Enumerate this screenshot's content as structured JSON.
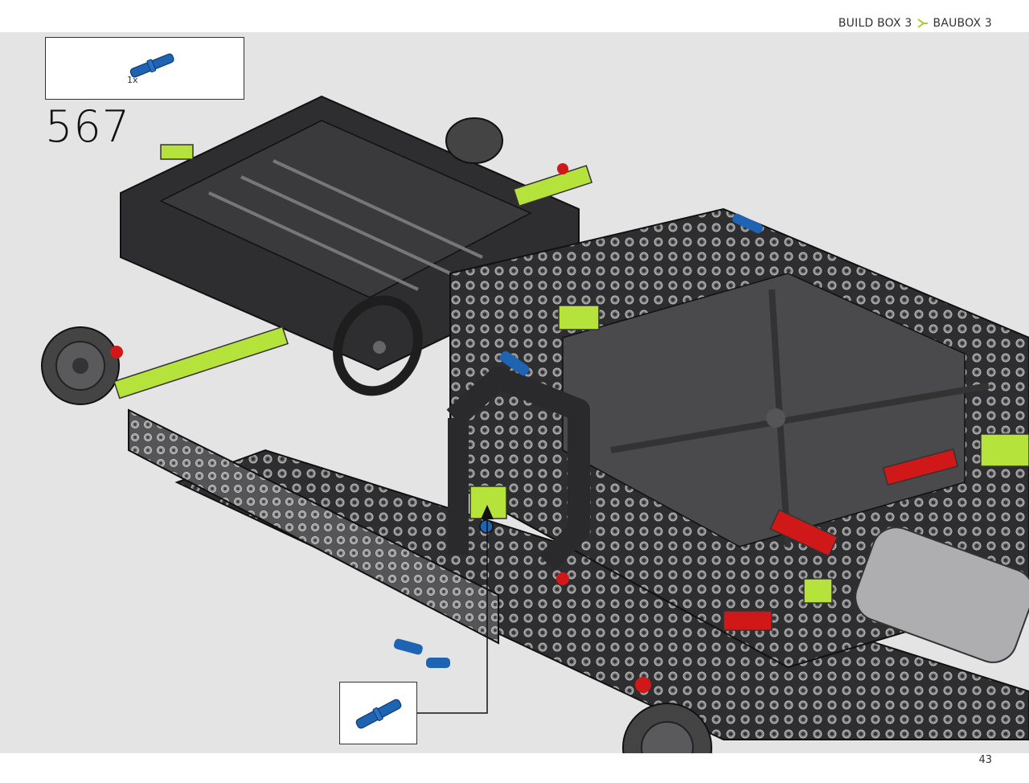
{
  "header": {
    "breadcrumb": {
      "primary": "BUILD BOX 3",
      "secondary": "BAUBOX 3",
      "arrow_color": "#a6ce39"
    }
  },
  "parts_list": {
    "items": [
      {
        "icon": "blue-pin-icon",
        "quantity": "1x",
        "color": "#1f63b3"
      }
    ]
  },
  "step": {
    "number": "567"
  },
  "callout": {
    "icon": "blue-pin-icon"
  },
  "page": {
    "number": "43"
  },
  "colors": {
    "stage_background": "#e4e4e4",
    "frame_dark": "#2e2e30",
    "frame_mid": "#555558",
    "accent_lime": "#b6e23c",
    "accent_red": "#d01818",
    "accent_blue": "#1f63b3"
  }
}
